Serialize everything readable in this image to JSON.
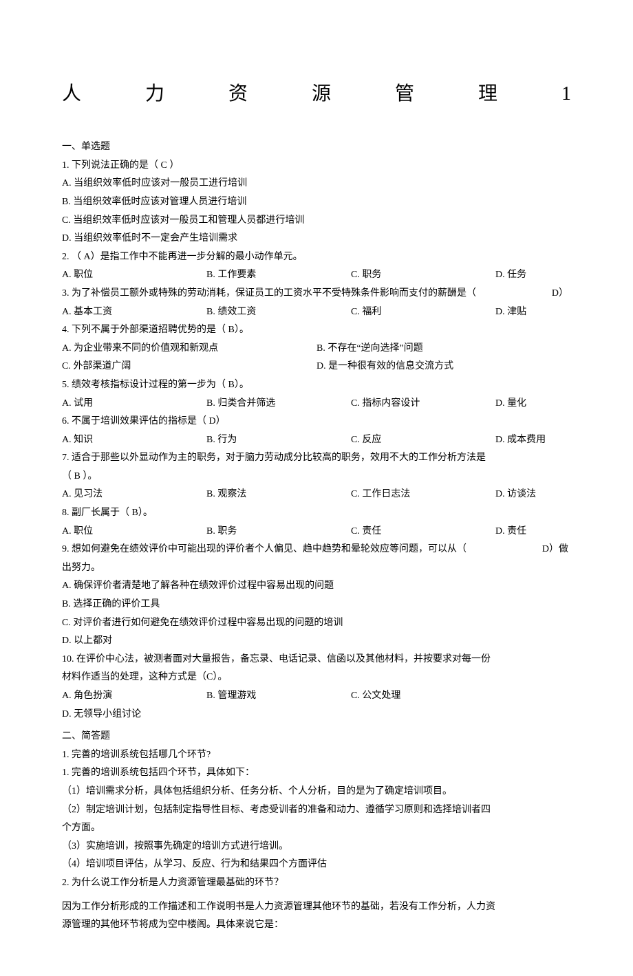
{
  "title": {
    "c1": "人",
    "c2": "力",
    "c3": "资",
    "c4": "源",
    "c5": "管",
    "c6": "理",
    "c7": "1"
  },
  "section1": "一、单选题",
  "q1": {
    "stem": "1. 下列说法正确的是（  C  ）",
    "a": "A. 当组织效率低时应该对一般员工进行培训",
    "b": "B. 当组织效率低时应该对管理人员进行培训",
    "c": "C. 当组织效率低时应该对一般员工和管理人员都进行培训",
    "d": "D. 当组织效率低时不一定会产生培训需求"
  },
  "q2": {
    "stem": "2. （ A）是指工作中不能再进一步分解的最小动作单元。",
    "a": "A. 职位",
    "b": "B. 工作要素",
    "c": "C. 职务",
    "d": "D. 任务"
  },
  "q3": {
    "stem": "3. 为了补偿员工额外或特殊的劳动消耗，保证员工的工资水平不受特殊条件影响而支付的薪酬是（",
    "tail": "D）",
    "a": "A. 基本工资",
    "b": "B. 绩效工资",
    "c": "C. 福利",
    "d": "D. 津贴"
  },
  "q4": {
    "stem": "4. 下列不属于外部渠道招聘优势的是（       B）。",
    "a": "A. 为企业带来不同的价值观和新观点",
    "b": "B. 不存在“逆向选择”问题",
    "c": "C. 外部渠道广阔",
    "d": "D. 是一种很有效的信息交流方式"
  },
  "q5": {
    "stem": "5. 绩效考核指标设计过程的第一步为（       B）。",
    "a": "A. 试用",
    "b": "B. 归类合并筛选",
    "c": "C. 指标内容设计",
    "d": "D. 量化"
  },
  "q6": {
    "stem": "6. 不属于培训效果评估的指标是（       D）",
    "a": "A. 知识",
    "b": "B. 行为",
    "c": "C. 反应",
    "d": "D. 成本费用"
  },
  "q7": {
    "stem1": "7. 适合于那些以外显动作为主的职务，对于脑力劳动成分比较高的职务，效用不大的工作分析方法是",
    "stem2": "（ B ）。",
    "a": "A. 见习法",
    "b": "B. 观察法",
    "c": "C. 工作日志法",
    "d": "D. 访谈法"
  },
  "q8": {
    "stem": "8. 副厂长属于（  B）。",
    "a": "A. 职位",
    "b": "B. 职务",
    "c": "C. 责任",
    "d": "D. 责任"
  },
  "q9": {
    "stem": "9. 想如何避免在绩效评价中可能出现的评价者个人偏见、趋中趋势和晕轮效应等问题，可以从（",
    "tail": "D）做",
    "stem2": "出努力。",
    "a": "A. 确保评价者清楚地了解各种在绩效评价过程中容易出现的问题",
    "b": "B. 选择正确的评价工具",
    "c": "C. 对评价者进行如何避免在绩效评价过程中容易出现的问题的培训",
    "d": "D. 以上都对"
  },
  "q10": {
    "stem1": "10. 在评价中心法，被测者面对大量报告，备忘录、电话记录、信函以及其他材料，并按要求对每一份",
    "stem2": "材料作适当的处理，这种方式是（C）。",
    "a": "A. 角色扮演",
    "b": "B. 管理游戏",
    "c": "C. 公文处理",
    "d": "D. 无领导小组讨论"
  },
  "section2": "二、简答题",
  "s1": {
    "q": "1. 完善的培训系统包括哪几个环节?",
    "a1": "1.  完善的培训系统包括四个环节，具体如下：",
    "a2": "（1）培训需求分析，具体包括组织分析、任务分析、个人分析，目的是为了确定培训项目。",
    "a3": "（2）制定培训计划，包括制定指导性目标、考虑受训者的准备和动力、遵循学习原则和选择培训者四",
    "a3b": "个方面。",
    "a4": "（3）实施培训，按照事先确定的培训方式进行培训。",
    "a5": "（4）培训项目评估，从学习、反应、行为和结果四个方面评估"
  },
  "s2": {
    "q": "2. 为什么说工作分析是人力资源管理最基础的环节？",
    "a1": "因为工作分析形成的工作描述和工作说明书是人力资源管理其他环节的基础，若没有工作分析，人力资",
    "a2": "源管理的其他环节将成为空中楼阁。具体来说它是："
  }
}
